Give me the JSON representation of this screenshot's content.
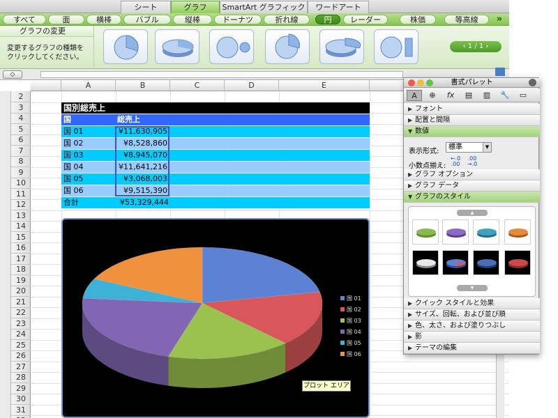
{
  "ribbon": {
    "tabs": [
      "シート",
      "グラフ",
      "SmartArt グラフィック",
      "ワードアート"
    ],
    "active_tab": "グラフ"
  },
  "chart_types": [
    "すべて",
    "面",
    "横棒",
    "バブル",
    "縦棒",
    "ドーナツ",
    "折れ線",
    "円",
    "レーダー",
    "株価",
    "等高線"
  ],
  "active_chart_type": "円",
  "more": "»",
  "gallery": {
    "change_label": "グラフの変更",
    "description": "変更するグラフの種類をクリックしてください。",
    "pager": "1 / 1"
  },
  "ruler_button": "◇",
  "columns": [
    "A",
    "B",
    "C",
    "D",
    "E"
  ],
  "rows": [
    "2",
    "3",
    "4",
    "5",
    "6",
    "7",
    "8",
    "9",
    "10",
    "11",
    "12",
    "13",
    "14",
    "15",
    "16",
    "17",
    "18",
    "19",
    "20",
    "21",
    "22",
    "23",
    "24",
    "25",
    "26",
    "27",
    "28",
    "29",
    "30",
    "31",
    "32"
  ],
  "table": {
    "title": "国別総売上",
    "header": [
      "国",
      "総売上"
    ],
    "rows": [
      [
        "国 01",
        "¥11,630,905"
      ],
      [
        "国 02",
        "¥8,528,860"
      ],
      [
        "国 03",
        "¥8,945,070"
      ],
      [
        "国 04",
        "¥11,641,216"
      ],
      [
        "国 05",
        "¥3,068,003"
      ],
      [
        "国 06",
        "¥9,515,390"
      ]
    ],
    "total": [
      "合計",
      "¥53,329,444"
    ]
  },
  "colors": {
    "header_blue": "#3366ff",
    "row_cyan": "#00ccff",
    "row_light": "#99ccff",
    "title_black": "#000000"
  },
  "chart_data": {
    "type": "pie",
    "categories": [
      "国 01",
      "国 02",
      "国 03",
      "国 04",
      "国 05",
      "国 06"
    ],
    "values": [
      11630905,
      8528860,
      8945070,
      11641216,
      3068003,
      9515390
    ],
    "colors": [
      "#5b82d4",
      "#d9575a",
      "#9bc24f",
      "#8167b3",
      "#3eb2d6",
      "#f0913e"
    ],
    "legend": "right",
    "style": "3d"
  },
  "tooltip": "プロット エリア",
  "palette": {
    "title": "書式パレット",
    "sections": [
      {
        "label": "フォント",
        "open": false
      },
      {
        "label": "配置と間隔",
        "open": false
      },
      {
        "label": "数値",
        "open": true
      },
      {
        "label": "グラフ オプション",
        "open": false
      },
      {
        "label": "グラフ データ",
        "open": false
      },
      {
        "label": "グラフのスタイル",
        "open": true
      },
      {
        "label": "クイック スタイルと効果",
        "open": false
      },
      {
        "label": "サイズ、回転、および並び順",
        "open": false
      },
      {
        "label": "色、太さ、および塗りつぶし",
        "open": false
      },
      {
        "label": "影",
        "open": false
      },
      {
        "label": "テーマの編集",
        "open": false
      }
    ],
    "number_format_label": "表示形式:",
    "number_format_value": "標準",
    "decimal_label": "小数点揃え:",
    "decimal_buttons": [
      "←.0 .00",
      ".00 →.0"
    ],
    "tool_icons": [
      "A",
      "⊕",
      "fx",
      "▤",
      "▥",
      "🔧",
      "▭"
    ]
  }
}
